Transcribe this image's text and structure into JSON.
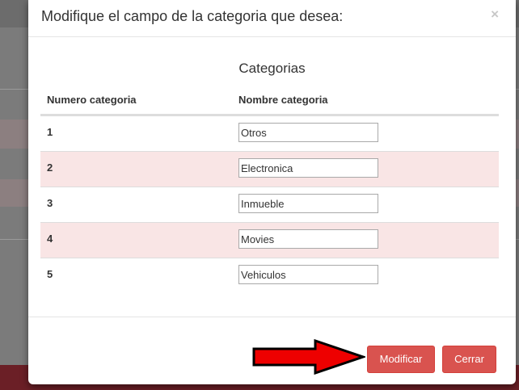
{
  "modal": {
    "title": "Modifique el campo de la categoria que desea:",
    "close_symbol": "×",
    "close_icon": "close-icon"
  },
  "table": {
    "caption": "Categorias",
    "headers": {
      "number": "Numero categoria",
      "name": "Nombre categoria"
    },
    "rows": [
      {
        "number": "1",
        "name": "Otros"
      },
      {
        "number": "2",
        "name": "Electronica"
      },
      {
        "number": "3",
        "name": "Inmueble"
      },
      {
        "number": "4",
        "name": "Movies"
      },
      {
        "number": "5",
        "name": "Vehiculos"
      }
    ]
  },
  "footer": {
    "modify_label": "Modificar",
    "close_label": "Cerrar",
    "arrow_icon": "arrow-right-icon"
  },
  "colors": {
    "button": "#d9534f",
    "stripe": "#f9e5e5",
    "arrow_fill": "#ee0000",
    "backdrop": "#7b7b7b"
  }
}
